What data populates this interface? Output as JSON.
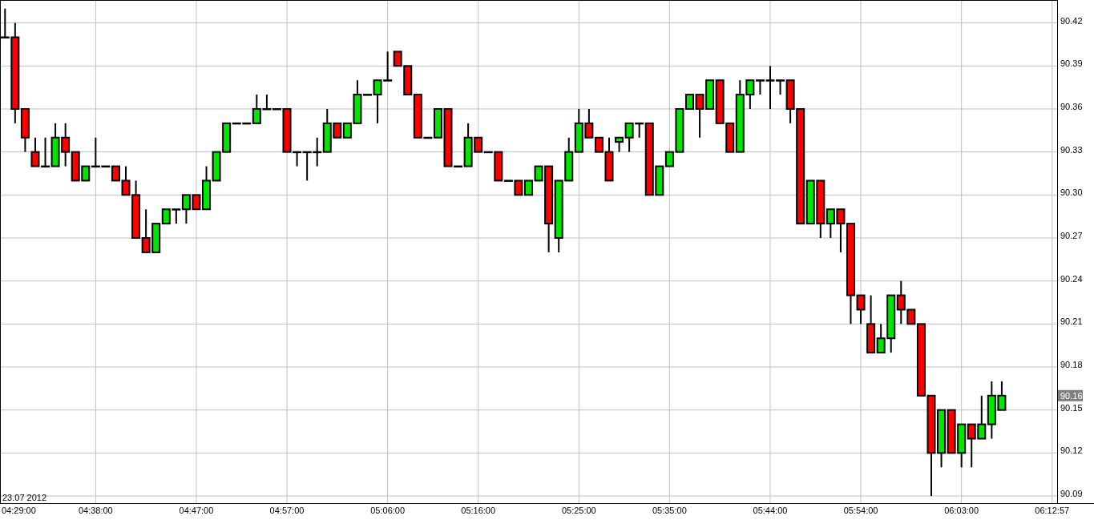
{
  "chart": {
    "date_label": "23.07 2012",
    "last_price_label": "90.16",
    "start_time_label": "04:29:00",
    "chart_data": {
      "type": "candlestick",
      "grid": true,
      "ylim": [
        90.085,
        90.436
      ],
      "categories": [
        null,
        null,
        null,
        null,
        null,
        null,
        null,
        null,
        null,
        "04:38:00",
        null,
        null,
        null,
        null,
        null,
        null,
        null,
        null,
        null,
        "04:47:00",
        null,
        null,
        null,
        null,
        null,
        null,
        null,
        null,
        "04:57:00",
        null,
        null,
        null,
        null,
        null,
        null,
        null,
        null,
        null,
        "05:06:00",
        null,
        null,
        null,
        null,
        null,
        null,
        null,
        null,
        "05:16:00",
        null,
        null,
        null,
        null,
        null,
        null,
        null,
        null,
        null,
        "05:25:00",
        null,
        null,
        null,
        null,
        null,
        null,
        null,
        null,
        "05:35:00",
        null,
        null,
        null,
        null,
        null,
        null,
        null,
        null,
        null,
        "05:44:00",
        null,
        null,
        null,
        null,
        null,
        null,
        null,
        null,
        "05:54:00",
        null,
        null,
        null,
        null,
        null,
        null,
        null,
        null,
        null,
        "06:03:00",
        null,
        null,
        null,
        null,
        null,
        null,
        null,
        null,
        "06:12:57"
      ],
      "yticks": [
        {
          "value": 90.42,
          "label": "90.42"
        },
        {
          "value": 90.39,
          "label": "90.39"
        },
        {
          "value": 90.36,
          "label": "90.36"
        },
        {
          "value": 90.33,
          "label": "90.33"
        },
        {
          "value": 90.3,
          "label": "90.30"
        },
        {
          "value": 90.27,
          "label": "90.27"
        },
        {
          "value": 90.24,
          "label": "90.24"
        },
        {
          "value": 90.21,
          "label": "90.21"
        },
        {
          "value": 90.18,
          "label": "90.18"
        },
        {
          "value": 90.15,
          "label": "90.15"
        },
        {
          "value": 90.12,
          "label": "90.12"
        },
        {
          "value": 90.09,
          "label": "90.09"
        }
      ],
      "ohlc": [
        [
          90.41,
          90.43,
          90.41,
          90.41
        ],
        [
          90.41,
          90.42,
          90.35,
          90.36
        ],
        [
          90.36,
          90.36,
          90.33,
          90.34
        ],
        [
          90.33,
          90.34,
          90.32,
          90.32
        ],
        [
          90.32,
          90.34,
          90.32,
          90.32
        ],
        [
          90.32,
          90.35,
          90.32,
          90.34
        ],
        [
          90.34,
          90.35,
          90.32,
          90.33
        ],
        [
          90.33,
          90.33,
          90.31,
          90.31
        ],
        [
          90.31,
          90.32,
          90.31,
          90.32
        ],
        [
          90.32,
          90.34,
          90.32,
          90.32
        ],
        [
          90.32,
          90.32,
          90.32,
          90.32
        ],
        [
          90.32,
          90.32,
          90.31,
          90.31
        ],
        [
          90.31,
          90.32,
          90.3,
          90.3
        ],
        [
          90.3,
          90.31,
          90.27,
          90.27
        ],
        [
          90.27,
          90.29,
          90.26,
          90.26
        ],
        [
          90.26,
          90.28,
          90.26,
          90.28
        ],
        [
          90.28,
          90.29,
          90.28,
          90.29
        ],
        [
          90.29,
          90.29,
          90.28,
          90.29
        ],
        [
          90.29,
          90.3,
          90.28,
          90.3
        ],
        [
          90.3,
          90.3,
          90.29,
          90.29
        ],
        [
          90.29,
          90.32,
          90.29,
          90.31
        ],
        [
          90.31,
          90.33,
          90.31,
          90.33
        ],
        [
          90.33,
          90.35,
          90.33,
          90.35
        ],
        [
          90.35,
          90.35,
          90.35,
          90.35
        ],
        [
          90.35,
          90.35,
          90.35,
          90.35
        ],
        [
          90.35,
          90.37,
          90.35,
          90.36
        ],
        [
          90.36,
          90.37,
          90.36,
          90.36
        ],
        [
          90.36,
          90.36,
          90.36,
          90.36
        ],
        [
          90.36,
          90.36,
          90.33,
          90.33
        ],
        [
          90.33,
          90.33,
          90.32,
          90.33
        ],
        [
          90.33,
          90.33,
          90.31,
          90.33
        ],
        [
          90.33,
          90.34,
          90.32,
          90.33
        ],
        [
          90.33,
          90.36,
          90.33,
          90.35
        ],
        [
          90.35,
          90.35,
          90.34,
          90.34
        ],
        [
          90.34,
          90.35,
          90.34,
          90.35
        ],
        [
          90.35,
          90.38,
          90.35,
          90.37
        ],
        [
          90.37,
          90.37,
          90.37,
          90.37
        ],
        [
          90.37,
          90.38,
          90.35,
          90.38
        ],
        [
          90.38,
          90.4,
          90.38,
          90.38
        ],
        [
          90.4,
          90.4,
          90.39,
          90.39
        ],
        [
          90.39,
          90.39,
          90.37,
          90.37
        ],
        [
          90.37,
          90.37,
          90.34,
          90.34
        ],
        [
          90.34,
          90.34,
          90.34,
          90.34
        ],
        [
          90.34,
          90.36,
          90.34,
          90.36
        ],
        [
          90.36,
          90.36,
          90.32,
          90.32
        ],
        [
          90.32,
          90.32,
          90.32,
          90.32
        ],
        [
          90.32,
          90.35,
          90.32,
          90.34
        ],
        [
          90.34,
          90.34,
          90.33,
          90.33
        ],
        [
          90.33,
          90.33,
          90.33,
          90.33
        ],
        [
          90.33,
          90.33,
          90.31,
          90.31
        ],
        [
          90.31,
          90.31,
          90.31,
          90.31
        ],
        [
          90.31,
          90.31,
          90.3,
          90.3
        ],
        [
          90.3,
          90.31,
          90.3,
          90.31
        ],
        [
          90.31,
          90.32,
          90.31,
          90.32
        ],
        [
          90.32,
          90.32,
          90.26,
          90.28
        ],
        [
          90.27,
          90.31,
          90.26,
          90.31
        ],
        [
          90.31,
          90.34,
          90.31,
          90.33
        ],
        [
          90.33,
          90.36,
          90.33,
          90.35
        ],
        [
          90.35,
          90.36,
          90.34,
          90.34
        ],
        [
          90.34,
          90.34,
          90.33,
          90.33
        ],
        [
          90.33,
          90.34,
          90.31,
          90.31
        ],
        [
          90.337,
          90.34,
          90.33,
          90.34
        ],
        [
          90.34,
          90.35,
          90.33,
          90.35
        ],
        [
          90.35,
          90.35,
          90.34,
          90.35
        ],
        [
          90.35,
          90.35,
          90.3,
          90.3
        ],
        [
          90.3,
          90.32,
          90.3,
          90.32
        ],
        [
          90.32,
          90.33,
          90.32,
          90.33
        ],
        [
          90.33,
          90.36,
          90.33,
          90.36
        ],
        [
          90.36,
          90.37,
          90.36,
          90.37
        ],
        [
          90.37,
          90.37,
          90.34,
          90.36
        ],
        [
          90.36,
          90.38,
          90.36,
          90.38
        ],
        [
          90.38,
          90.38,
          90.35,
          90.35
        ],
        [
          90.35,
          90.35,
          90.33,
          90.33
        ],
        [
          90.33,
          90.38,
          90.33,
          90.37
        ],
        [
          90.37,
          90.38,
          90.36,
          90.38
        ],
        [
          90.38,
          90.38,
          90.37,
          90.38
        ],
        [
          90.38,
          90.39,
          90.36,
          90.38
        ],
        [
          90.38,
          90.38,
          90.37,
          90.38
        ],
        [
          90.38,
          90.38,
          90.35,
          90.36
        ],
        [
          90.36,
          90.36,
          90.28,
          90.28
        ],
        [
          90.28,
          90.31,
          90.28,
          90.31
        ],
        [
          90.31,
          90.31,
          90.27,
          90.28
        ],
        [
          90.28,
          90.29,
          90.27,
          90.29
        ],
        [
          90.29,
          90.29,
          90.26,
          90.28
        ],
        [
          90.28,
          90.28,
          90.21,
          90.23
        ],
        [
          90.23,
          90.23,
          90.21,
          90.22
        ],
        [
          90.21,
          90.23,
          90.19,
          90.19
        ],
        [
          90.19,
          90.21,
          90.19,
          90.2
        ],
        [
          90.2,
          90.23,
          90.19,
          90.23
        ],
        [
          90.23,
          90.24,
          90.21,
          90.22
        ],
        [
          90.22,
          90.22,
          90.21,
          90.21
        ],
        [
          90.21,
          90.21,
          90.16,
          90.16
        ],
        [
          90.16,
          90.16,
          90.09,
          90.12
        ],
        [
          90.12,
          90.15,
          90.11,
          90.15
        ],
        [
          90.15,
          90.15,
          90.12,
          90.12
        ],
        [
          90.12,
          90.14,
          90.11,
          90.14
        ],
        [
          90.14,
          90.14,
          90.11,
          90.13
        ],
        [
          90.13,
          90.16,
          90.13,
          90.14
        ],
        [
          90.14,
          90.17,
          90.13,
          90.16
        ],
        [
          90.15,
          90.17,
          90.15,
          90.16
        ],
        null,
        null,
        null,
        null,
        null
      ]
    }
  }
}
